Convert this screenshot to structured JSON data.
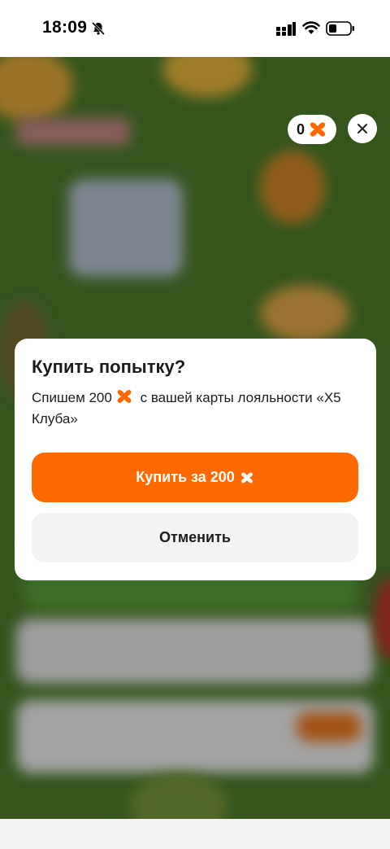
{
  "status_bar": {
    "time": "18:09",
    "icons": [
      "bell-slash-icon",
      "signal-icon",
      "wifi-icon",
      "battery-icon"
    ]
  },
  "header": {
    "points_value": "0",
    "points_icon": "x5-coin-icon",
    "close_icon": "close-icon"
  },
  "modal": {
    "title": "Купить попытку?",
    "text_before_coin": "Спишем 200",
    "text_after_coin": "с вашей карты лояльности «Х5 Клуба»",
    "buy_label": "Купить за 200",
    "cancel_label": "Отменить"
  },
  "colors": {
    "accent": "#ff6a00",
    "background_game": "#4e7e2c",
    "cancel_bg": "#f3f3f3"
  }
}
